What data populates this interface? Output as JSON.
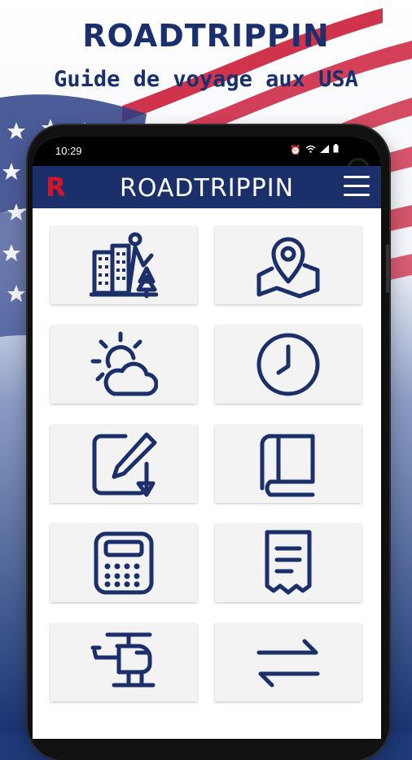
{
  "promo": {
    "title": "ROADTRIPPIN",
    "subtitle": "Guide de voyage aux USA"
  },
  "status_bar": {
    "time": "10:29"
  },
  "app_bar": {
    "logo_letter": "R",
    "title": "ROADTRIPPIN"
  },
  "tiles": [
    {
      "icon": "city-icon"
    },
    {
      "icon": "map-pin-icon"
    },
    {
      "icon": "weather-icon"
    },
    {
      "icon": "clock-icon"
    },
    {
      "icon": "edit-note-icon"
    },
    {
      "icon": "book-icon"
    },
    {
      "icon": "calculator-icon"
    },
    {
      "icon": "receipt-icon"
    },
    {
      "icon": "helicopter-icon"
    },
    {
      "icon": "swap-arrows-icon"
    }
  ],
  "colors": {
    "brand_navy": "#1b2f6b",
    "logo_red": "#d3132a",
    "tile_bg": "#f3f3f3"
  }
}
